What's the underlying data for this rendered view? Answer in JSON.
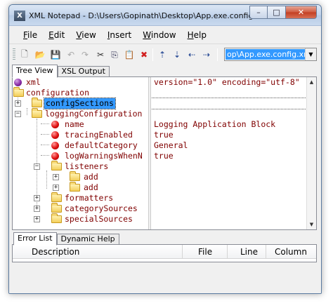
{
  "window": {
    "title": "XML Notepad - D:\\Users\\Gopinath\\Desktop\\App.exe.config.xml",
    "app_icon_letter": "X",
    "minimize_icon": "minimize-icon",
    "maximize_icon": "maximize-icon",
    "close_icon": "close-icon",
    "minimize_glyph": "–",
    "maximize_glyph": "□",
    "close_glyph": "✕"
  },
  "menu": [
    {
      "hotkey": "F",
      "rest": "ile"
    },
    {
      "hotkey": "E",
      "rest": "dit"
    },
    {
      "hotkey": "V",
      "rest": "iew"
    },
    {
      "hotkey": "I",
      "rest": "nsert"
    },
    {
      "hotkey": "W",
      "rest": "indow"
    },
    {
      "hotkey": "H",
      "rest": "elp"
    }
  ],
  "toolbar": {
    "icons": [
      "new-file-icon",
      "open-folder-icon",
      "save-icon",
      "undo-icon",
      "redo-icon",
      "cut-icon",
      "copy-icon",
      "paste-icon",
      "delete-icon",
      "nudge-up-icon",
      "nudge-down-icon",
      "nudge-left-icon",
      "nudge-right-icon"
    ],
    "glyphs": {
      "new": "🗋",
      "open": "📂",
      "save": "💾",
      "undo": "↶",
      "redo": "↷",
      "cut": "✂",
      "copy": "⎘",
      "paste": "📋",
      "delete": "✖",
      "up": "⇡",
      "down": "⇣",
      "left": "⇠",
      "right": "⇢"
    },
    "file_combo_value": "op\\App.exe.config.xml",
    "file_combo_arrow": "▼"
  },
  "top_tabs": {
    "tree_view": "Tree View",
    "xsl_output": "XSL Output"
  },
  "tree": {
    "nodes": [
      {
        "label": "xml"
      },
      {
        "label": "configuration"
      },
      {
        "label": "configSections"
      },
      {
        "label": "loggingConfiguration"
      },
      {
        "label": "name"
      },
      {
        "label": "tracingEnabled"
      },
      {
        "label": "defaultCategory"
      },
      {
        "label": "logWarningsWhenN"
      },
      {
        "label": "listeners"
      },
      {
        "label": "add"
      },
      {
        "label": "add"
      },
      {
        "label": "formatters"
      },
      {
        "label": "categorySources"
      },
      {
        "label": "specialSources"
      }
    ],
    "expand_plus": "+",
    "expand_minus": "−"
  },
  "values": {
    "xml": "version=\"1.0\" encoding=\"utf-8\"",
    "name": "Logging Application Block",
    "tracingEnabled": "true",
    "defaultCategory": "General",
    "logWarningsWhenN": "true"
  },
  "scroll": {
    "up": "▲",
    "down": "▼"
  },
  "bottom_tabs": {
    "error_list": "Error List",
    "dynamic_help": "Dynamic Help"
  },
  "error_list": {
    "columns": [
      "Description",
      "File",
      "Line",
      "Column"
    ]
  },
  "colors": {
    "selection": "#3399ff",
    "tree_text": "#800000"
  }
}
